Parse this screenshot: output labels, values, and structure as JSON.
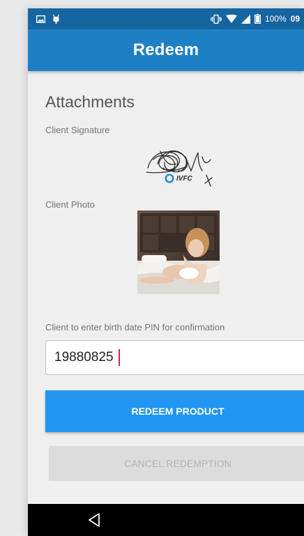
{
  "status_bar": {
    "battery_text": "100%",
    "time": "09",
    "icons": [
      "image-icon",
      "android-debug-icon",
      "vibrate-icon",
      "wifi-icon",
      "signal-icon",
      "battery-icon"
    ]
  },
  "app_bar": {
    "title": "Redeem"
  },
  "attachments": {
    "heading": "Attachments",
    "signature_label": "Client Signature",
    "signature_watermark": "IVFC",
    "photo_label": "Client Photo"
  },
  "pin": {
    "label": "Client to enter birth date PIN for confirmation",
    "value": "19880825"
  },
  "actions": {
    "redeem_label": "REDEEM PRODUCT",
    "cancel_label": "CANCEL REDEMPTION"
  },
  "colors": {
    "status_bar": "#1565a0",
    "app_bar": "#1e80c4",
    "primary_button": "#2196f3",
    "disabled_button": "#dcdcdc",
    "caret": "#d81b60"
  },
  "nav_bar": {
    "icons": [
      "back-icon"
    ]
  }
}
